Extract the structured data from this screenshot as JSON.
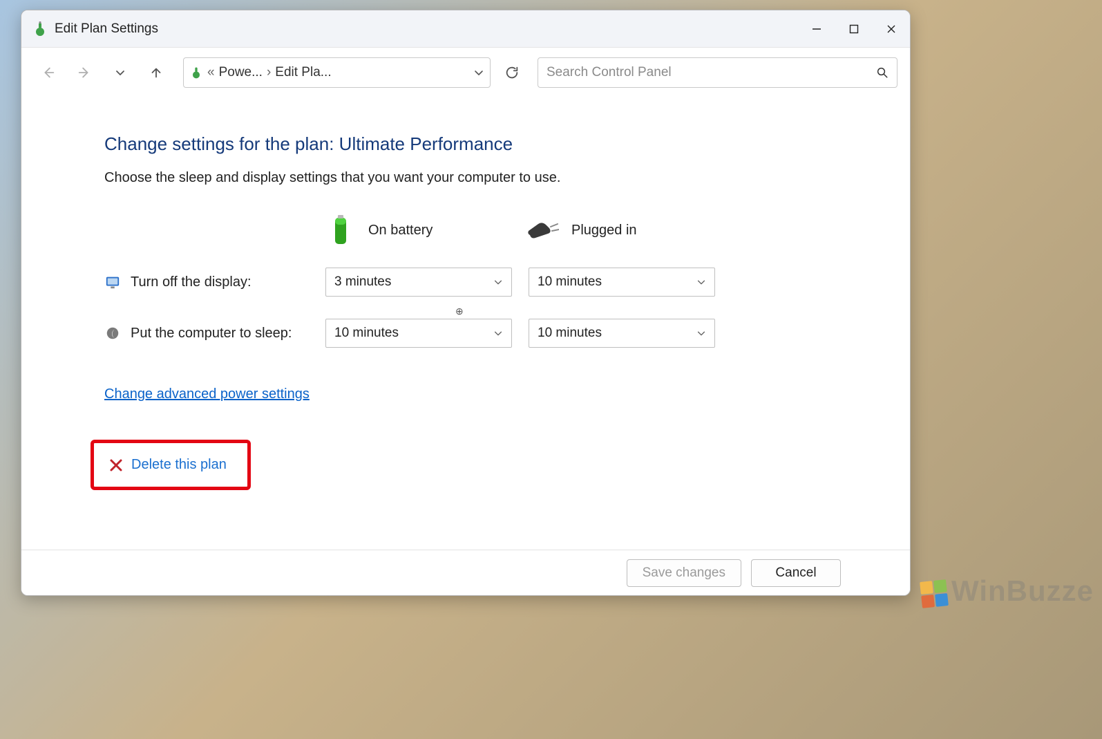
{
  "window": {
    "title": "Edit Plan Settings"
  },
  "breadcrumb": {
    "parent": "Powe...",
    "current": "Edit Pla..."
  },
  "search": {
    "placeholder": "Search Control Panel"
  },
  "page": {
    "heading": "Change settings for the plan: Ultimate Performance",
    "subtext": "Choose the sleep and display settings that you want your computer to use."
  },
  "columns": {
    "battery": "On battery",
    "plugged": "Plugged in"
  },
  "rows": {
    "display": {
      "label": "Turn off the display:",
      "battery": "3 minutes",
      "plugged": "10 minutes"
    },
    "sleep": {
      "label": "Put the computer to sleep:",
      "battery": "10 minutes",
      "plugged": "10 minutes"
    }
  },
  "links": {
    "advanced": "Change advanced power settings",
    "delete": "Delete this plan"
  },
  "footer": {
    "save": "Save changes",
    "cancel": "Cancel"
  },
  "watermark": "WinBuzze"
}
